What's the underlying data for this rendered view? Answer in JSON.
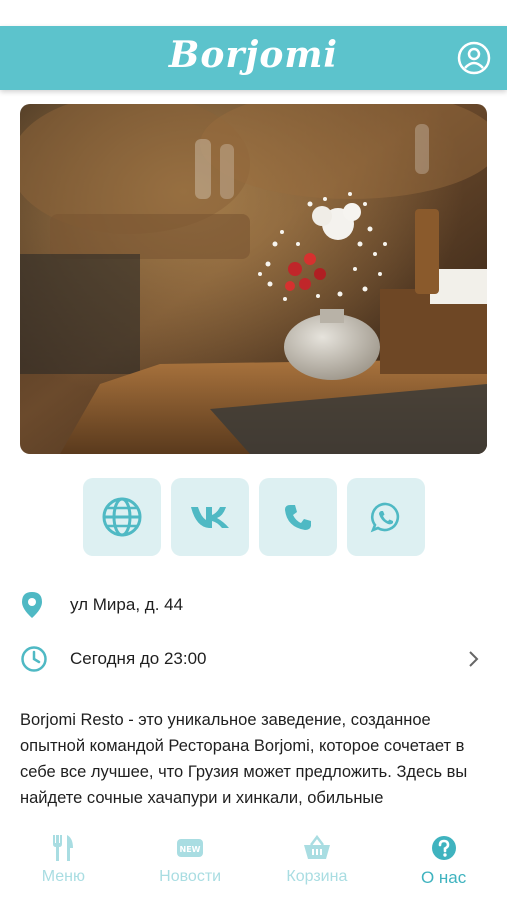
{
  "header": {
    "logo_text": "Borjomi",
    "brand_color": "#5cc3cc",
    "profile_icon": "user-circle-icon"
  },
  "hero": {
    "image_name": "restaurant-interior-photo"
  },
  "contacts": [
    {
      "icon": "globe-icon"
    },
    {
      "icon": "vk-icon"
    },
    {
      "icon": "phone-icon"
    },
    {
      "icon": "whatsapp-icon"
    }
  ],
  "info": {
    "address": "ул Мира, д. 44",
    "hours": "Сегодня до 23:00"
  },
  "description": "Borjomi Resto - это уникальное заведение, созданное опытной командой Ресторана Borjomi, которое сочетает в себе все лучшее, что Грузия может предложить. Здесь вы найдете сочные хачапури и хинкали, обильные",
  "tabbar": {
    "active_color": "#3fb3bf",
    "inactive_color": "#a9dde2",
    "tabs": [
      {
        "label": "Меню",
        "icon": "fork-knife-icon"
      },
      {
        "label": "Новости",
        "icon": "news-icon"
      },
      {
        "label": "Корзина",
        "icon": "basket-icon"
      },
      {
        "label": "О нас",
        "icon": "question-icon"
      }
    ]
  }
}
